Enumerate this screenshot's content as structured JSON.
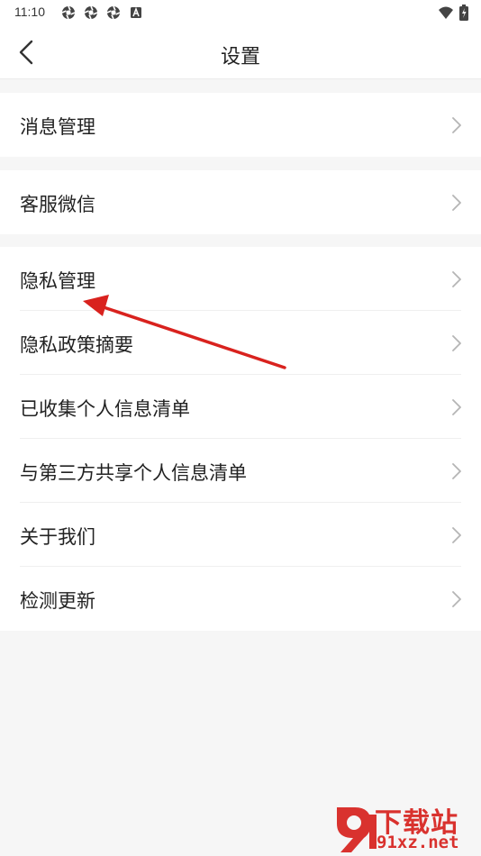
{
  "status_bar": {
    "time": "11:10",
    "left_icons": [
      "aperture-icon",
      "aperture-icon",
      "aperture-icon",
      "a-box-icon"
    ],
    "right_icons": [
      "wifi-icon",
      "battery-charging-icon"
    ]
  },
  "header": {
    "title": "设置",
    "back_icon": "chevron-left-icon"
  },
  "groups": [
    {
      "items": [
        {
          "label": "消息管理"
        }
      ]
    },
    {
      "items": [
        {
          "label": "客服微信"
        }
      ]
    },
    {
      "items": [
        {
          "label": "隐私管理"
        },
        {
          "label": "隐私政策摘要"
        },
        {
          "label": "已收集个人信息清单"
        },
        {
          "label": "与第三方共享个人信息清单"
        },
        {
          "label": "关于我们"
        },
        {
          "label": "检测更新"
        }
      ]
    }
  ],
  "annotation": {
    "color": "#d9221e",
    "target": "隐私管理"
  },
  "watermark": {
    "title": "下载站",
    "url": "91xz.net",
    "color": "#d9322e"
  },
  "colors": {
    "background": "#f6f6f6",
    "card": "#ffffff",
    "text": "#222222",
    "chevron": "#b5b5b5"
  }
}
